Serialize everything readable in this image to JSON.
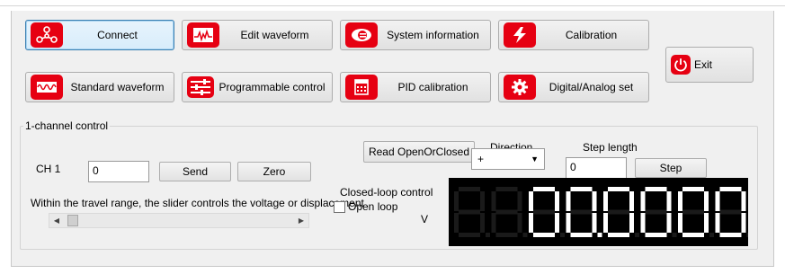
{
  "toolbar": {
    "connect": "Connect",
    "edit_waveform": "Edit waveform",
    "system_information": "System information",
    "calibration": "Calibration",
    "standard_waveform": "Standard waveform",
    "programmable_control": "Programmable control",
    "pid_calibration": "PID calibration",
    "digital_analog_set": "Digital/Analog set",
    "exit": "Exit"
  },
  "channel_group": {
    "title": "1-channel control",
    "channel_label": "CH 1",
    "channel_value": "0",
    "send": "Send",
    "zero": "Zero",
    "read_open_closed": "Read OpenOrClosed",
    "direction_label": "Direction",
    "direction_value": "+",
    "step_length_label": "Step length",
    "step_length_value": "0",
    "step": "Step",
    "slider_hint": "Within the travel range, the slider controls the voltage or displacement",
    "slider_level": 0,
    "closed_loop_label": "Closed-loop control",
    "open_loop_label": "Open loop",
    "open_loop_checked": false,
    "unit": "V",
    "display_value": "00.0000"
  },
  "colors": {
    "icon_red": "#e60012",
    "segment_on": "#ffffff",
    "segment_off": "#1a1a1a"
  },
  "icons": [
    "connect-icon",
    "waveform-icon",
    "eye-icon",
    "lightning-icon",
    "wave-icon",
    "sliders-icon",
    "calendar-icon",
    "gear-icon",
    "power-icon"
  ]
}
